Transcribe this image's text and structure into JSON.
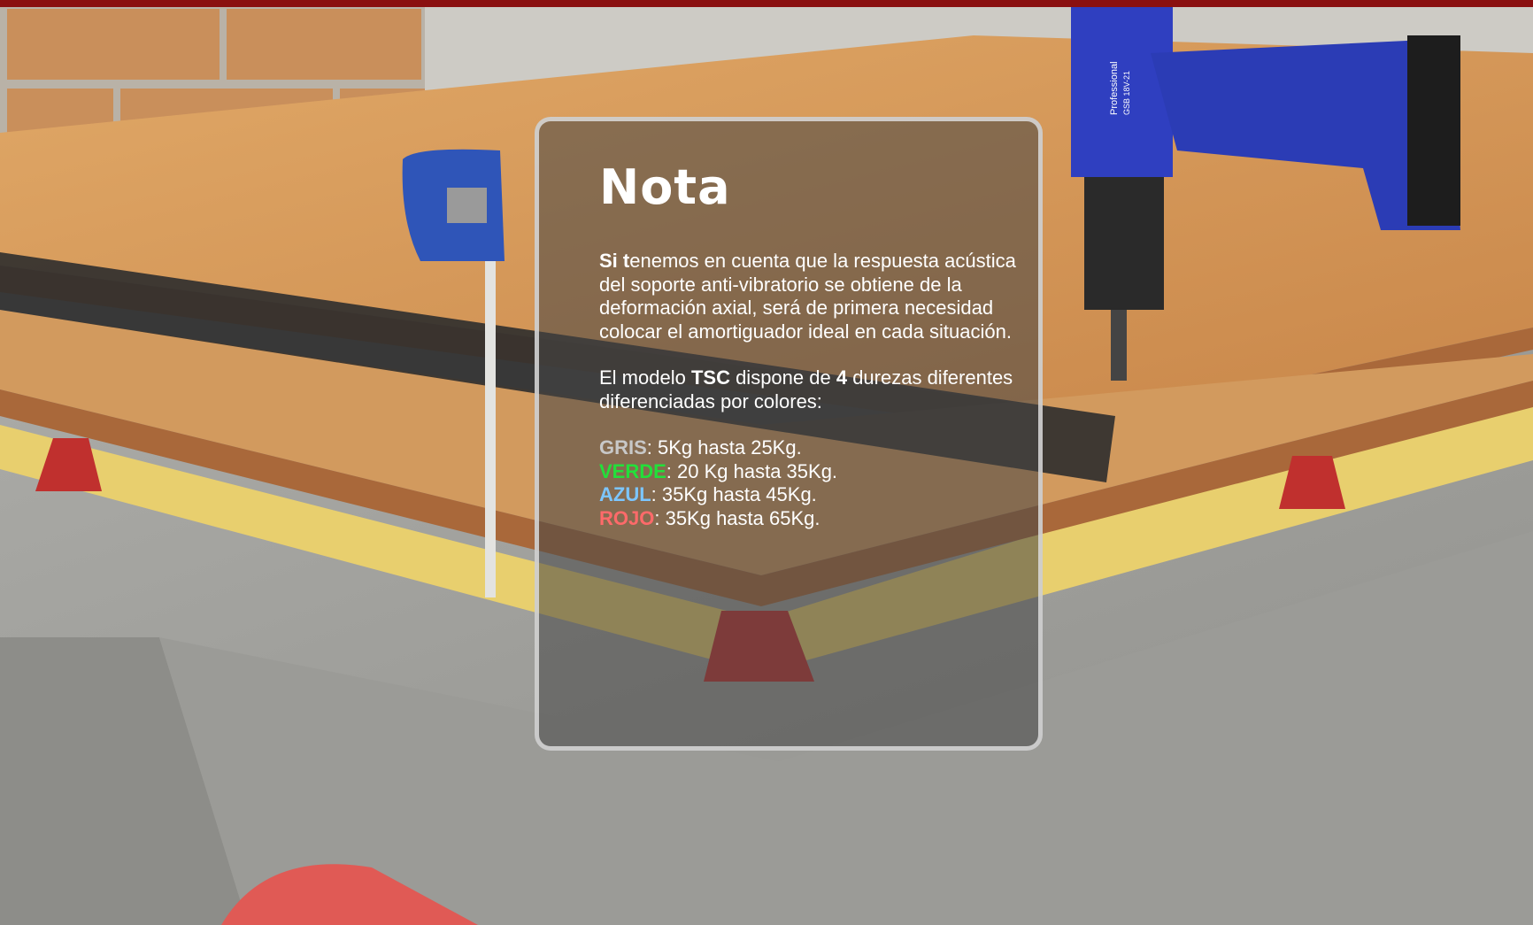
{
  "colors": {
    "frame_accent": "#8a1010",
    "gris": "#c8c8c8",
    "verde": "#22e03a",
    "azul": "#7cc6ff",
    "rojo": "#ff6a6a"
  },
  "illustration": {
    "drill_text_1": "Professional",
    "drill_text_2": "GSB 18V-21"
  },
  "note": {
    "title": "Nota",
    "para1_bold": "Si t",
    "para1_rest": "enemos en cuenta que la respuesta acústica del soporte anti-vibratorio se obtiene de la deformación axial, será de primera necesidad colocar el amortiguador ideal en cada situación.",
    "para2_a": "El modelo ",
    "para2_model": "TSC",
    "para2_b": " dispone de ",
    "para2_count": "4",
    "para2_c": " durezas diferentes diferenciadas por colores:",
    "hardness": [
      {
        "color_name": "GRIS",
        "range": ": 5Kg hasta 25Kg."
      },
      {
        "color_name": "VERDE",
        "range": ": 20 Kg hasta 35Kg."
      },
      {
        "color_name": "AZUL",
        "range": ": 35Kg hasta 45Kg."
      },
      {
        "color_name": "ROJO",
        "range": ": 35Kg hasta 65Kg."
      }
    ]
  }
}
